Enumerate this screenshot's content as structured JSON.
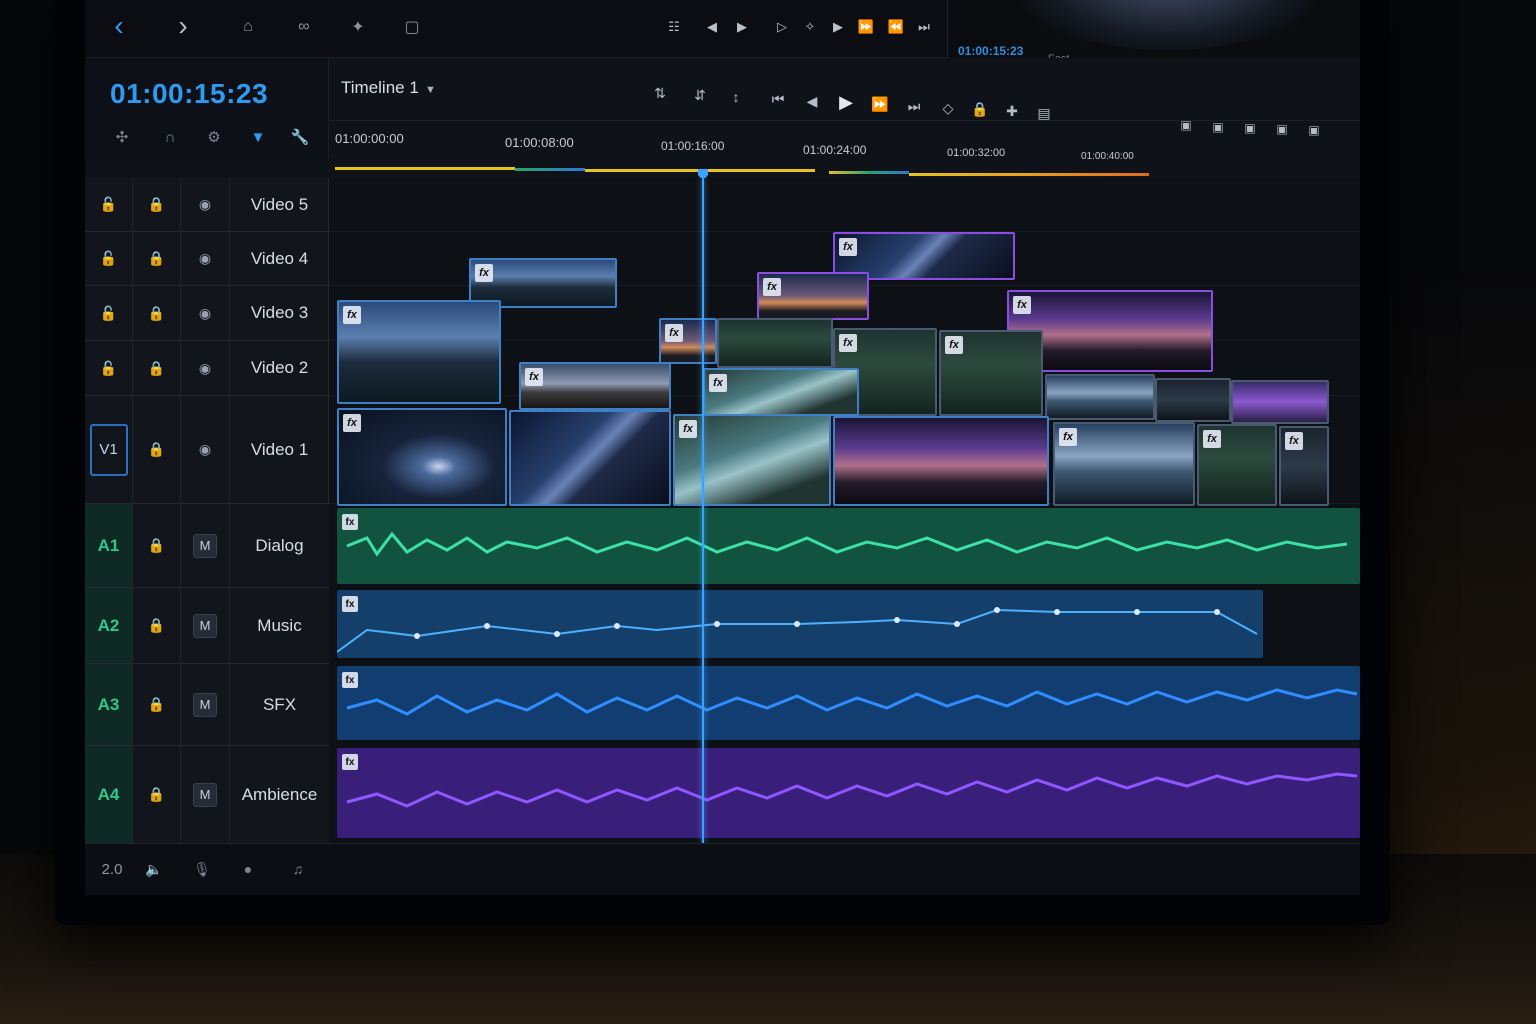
{
  "app": {
    "timecode": "01:00:15:23",
    "timeline_name": "Timeline 1",
    "footer_audio_format": "2.0"
  },
  "viewer": {
    "timecode": "01:00:15:23",
    "label": "Fast"
  },
  "ruler": {
    "labels": [
      "01:00:00:00",
      "01:00:08:00",
      "01:00:16:00",
      "01:00:24:00",
      "01:00:32:00",
      "01:00:40:00"
    ]
  },
  "tracks": {
    "video": [
      {
        "name": "Video 5"
      },
      {
        "name": "Video 4"
      },
      {
        "name": "Video 3"
      },
      {
        "name": "Video 2"
      },
      {
        "name": "Video 1",
        "badge": "V1"
      }
    ],
    "audio": [
      {
        "badge": "A1",
        "name": "Dialog",
        "mute": "M",
        "color": "#1f9e7a"
      },
      {
        "badge": "A2",
        "name": "Music",
        "mute": "M",
        "color": "#1c5e9a"
      },
      {
        "badge": "A3",
        "name": "SFX",
        "mute": "M",
        "color": "#1a5fae"
      },
      {
        "badge": "A4",
        "name": "Ambience",
        "mute": "M",
        "color": "#5a2fae"
      }
    ]
  },
  "clip_fx_label": "fx",
  "colors": {
    "accent": "#2e9bf0",
    "audio_badge": "#2dc98a",
    "clip_border_blue": "#3f7fc4",
    "clip_border_purple": "#8a4fe0"
  },
  "icons": {
    "back": "chevron-left-icon",
    "forward": "chevron-right-icon",
    "play": "play-icon",
    "lock": "lock-icon",
    "eye": "eye-icon"
  }
}
